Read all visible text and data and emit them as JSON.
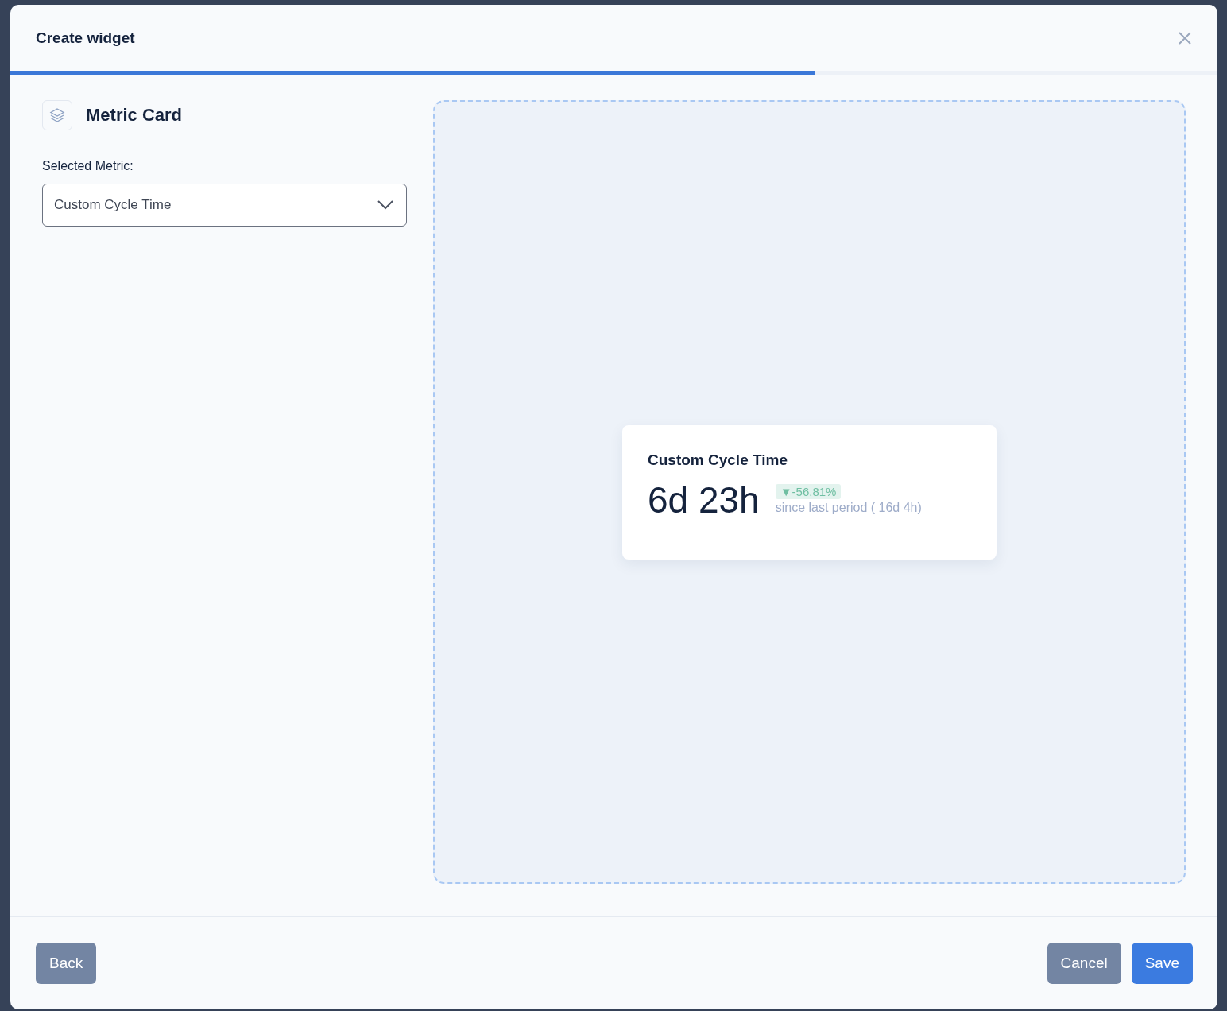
{
  "dialog": {
    "title": "Create widget",
    "progress": {
      "level": 0.666
    }
  },
  "widget_type": {
    "name": "Metric Card"
  },
  "metric_select": {
    "label": "Selected Metric:",
    "value": "Custom Cycle Time"
  },
  "preview": {
    "card": {
      "title": "Custom Cycle Time",
      "value": "6d 23h",
      "change": "▼-56.81%",
      "comparison": "since last period ( 16d 4h)"
    }
  },
  "footer": {
    "buttons": [
      {
        "label": "Back",
        "kind": "secondary"
      },
      {
        "label": "Cancel",
        "kind": "secondary"
      },
      {
        "label": "Save",
        "kind": "primary"
      }
    ]
  }
}
